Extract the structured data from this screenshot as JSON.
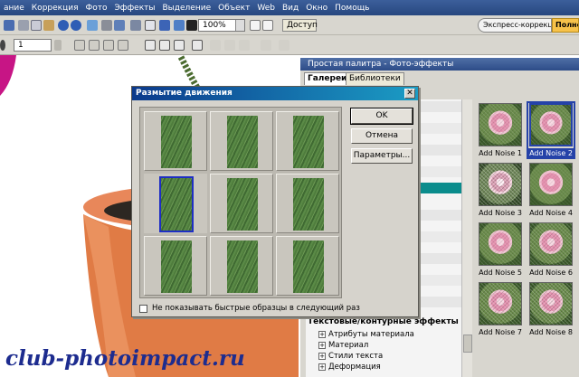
{
  "menubar": {
    "items": [
      "ание",
      "Коррекция",
      "Фото",
      "Эффекты",
      "Выделение",
      "Объект",
      "Web",
      "Вид",
      "Окно",
      "Помощь"
    ]
  },
  "toolbar": {
    "zoom_value": "100%",
    "access_label": "Доступ",
    "express_label": "Экспресс-коррекц...",
    "full_label": "Полно",
    "number_value": "1"
  },
  "canvas": {
    "watermark": "club-photoimpact.ru"
  },
  "panel": {
    "title": "Простая палитра - Фото-эффекты",
    "tabs": [
      "Галереи",
      "Библиотеки"
    ],
    "category_header": "Текстовые/контурные эффекты",
    "categories": [
      "Атрибуты материала",
      "Материал",
      "Стили текста",
      "Деформация"
    ],
    "gallery": [
      {
        "label": "Add Noise 1",
        "selected": false
      },
      {
        "label": "Add Noise 2",
        "selected": true
      },
      {
        "label": "Add Noise 3",
        "selected": false
      },
      {
        "label": "Add Noise 4",
        "selected": false
      },
      {
        "label": "Add Noise 5",
        "selected": false
      },
      {
        "label": "Add Noise 6",
        "selected": false
      },
      {
        "label": "Add Noise 7",
        "selected": false
      },
      {
        "label": "Add Noise 8",
        "selected": false
      }
    ]
  },
  "dialog": {
    "title": "Размытие движения",
    "close": "✕",
    "ok_label": "OK",
    "cancel_label": "Отмена",
    "params_label": "Параметры...",
    "checkbox_label": "Не показывать быстрые образцы в следующий раз",
    "selected_cell": 3
  },
  "colors": {
    "accent": "#2542a8",
    "dialog_title_start": "#0c3a8c",
    "dialog_title_end": "#1b9cc4",
    "pot": "#e07b45",
    "watermark": "#1d2c8f"
  }
}
